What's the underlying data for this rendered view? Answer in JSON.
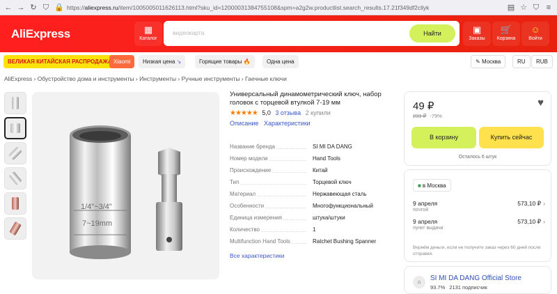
{
  "browser": {
    "url_prefix": "https://",
    "url_domain": "aliexpress.ru",
    "url_rest": "/item/1005005011626113.html?sku_id=12000031384755108&spm=a2g2w.productlist.search_results.17.21f349df2cllyk"
  },
  "header": {
    "logo": "AliExpress",
    "catalog_label": "Каталог",
    "search_placeholder": "видеокарта",
    "search_button": "Найти",
    "orders_label": "Заказы",
    "cart_label": "Корзина",
    "login_label": "Войти"
  },
  "promo": {
    "sale": "ВЕЛИКАЯ КИТАЙСКАЯ РАСПРОДАЖА",
    "brand": "Xiaomi",
    "low_price": "Низкая цена",
    "hot": "Горящие товары",
    "one_price": "Одна цена",
    "city": "Москва",
    "lang": "RU",
    "currency": "RUB"
  },
  "breadcrumb": "AliExpress  ›  Обустройство дома и инструменты  ›  Инструменты  ›  Ручные инструменты  ›  Гаечные ключи",
  "product": {
    "title": "Универсальный динамометрический ключ, набор головок с торцевой втулкой 7-19 мм",
    "stars": "★★★★★",
    "score": "5,0",
    "reviews": "3 отзыва",
    "bought": "2 купили",
    "tab_description": "Описание",
    "tab_specs": "Характеристики",
    "specs": [
      {
        "k": "Название бренда",
        "v": "SI MI DA DANG"
      },
      {
        "k": "Номер модели",
        "v": "Hand Tools"
      },
      {
        "k": "Происхождение",
        "v": "Китай"
      },
      {
        "k": "Тип",
        "v": "Торцевой ключ"
      },
      {
        "k": "Материал",
        "v": "Нержавеющая сталь"
      },
      {
        "k": "Особенности",
        "v": "Многофункциональный"
      },
      {
        "k": "Единица измерения",
        "v": "штука/штуки"
      },
      {
        "k": "Количество",
        "v": "1"
      },
      {
        "k": "Multifunction Hand Tools",
        "v": "Ratchet Bushing Spanner"
      }
    ],
    "all_specs": "Все характеристики"
  },
  "buy": {
    "price": "49 ₽",
    "old_price": "231 ₽",
    "discount": "-79%",
    "cart_button": "В корзину",
    "buy_button": "Купить сейчас",
    "stock": "Осталось 6 штук"
  },
  "delivery": {
    "city": "в Москва",
    "options": [
      {
        "date": "9 апреля",
        "method": "почтой",
        "price": "573,10 ₽"
      },
      {
        "date": "9 апреля",
        "method": "пункт выдачи",
        "price": "573,10 ₽"
      }
    ],
    "refund": "Вернём деньги, если не получите заказ через 60 дней после отправки."
  },
  "store": {
    "name": "SI MI DA DANG Official Store",
    "rating": "93.7%",
    "subscribers": "2131 подписчик"
  },
  "colors": {
    "brand_red": "#ff1f1f",
    "accent_green": "#d4f05a",
    "accent_yellow": "#ffe14d",
    "link_blue": "#3a57c6",
    "star_orange": "#fd7b03"
  }
}
